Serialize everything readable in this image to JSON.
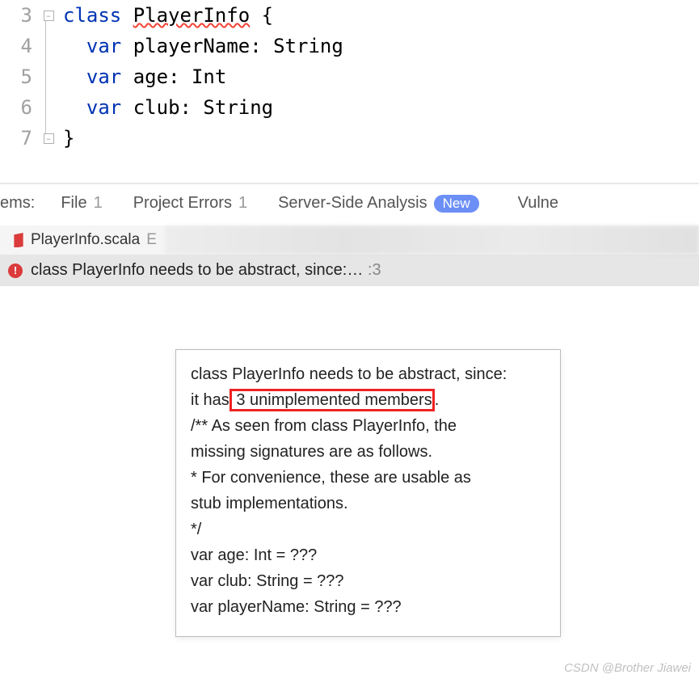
{
  "editor": {
    "lines": [
      {
        "num": "3",
        "indent": "  ",
        "tokens": [
          {
            "t": "keyword",
            "v": "class"
          },
          {
            "t": "sp",
            "v": " "
          },
          {
            "t": "squiggly",
            "v": "PlayerInfo"
          },
          {
            "t": "plain",
            "v": " {"
          }
        ],
        "fold": "open-top"
      },
      {
        "num": "4",
        "indent": "    ",
        "tokens": [
          {
            "t": "keyword",
            "v": "var"
          },
          {
            "t": "sp",
            "v": " "
          },
          {
            "t": "plain",
            "v": "playerName: String"
          }
        ]
      },
      {
        "num": "5",
        "indent": "    ",
        "tokens": [
          {
            "t": "keyword",
            "v": "var"
          },
          {
            "t": "sp",
            "v": " "
          },
          {
            "t": "plain",
            "v": "age: Int"
          }
        ]
      },
      {
        "num": "6",
        "indent": "    ",
        "tokens": [
          {
            "t": "keyword",
            "v": "var"
          },
          {
            "t": "sp",
            "v": " "
          },
          {
            "t": "plain",
            "v": "club: String"
          }
        ]
      },
      {
        "num": "7",
        "indent": "  ",
        "tokens": [
          {
            "t": "plain",
            "v": "}"
          }
        ],
        "fold": "open-bottom"
      }
    ]
  },
  "problems": {
    "left_label": "ems:",
    "tabs": {
      "file": {
        "label": "File",
        "count": "1"
      },
      "project": {
        "label": "Project Errors",
        "count": "1"
      },
      "server": {
        "label": "Server-Side Analysis",
        "badge": "New"
      },
      "vulne": {
        "label": "Vulne"
      }
    }
  },
  "file_tab": {
    "filename": "PlayerInfo.scala",
    "extra": "E"
  },
  "error_row": {
    "message": "class PlayerInfo needs to be abstract, since:…",
    "loc": ":3"
  },
  "tooltip": {
    "line1_pre": "class PlayerInfo needs to be abstract, since:",
    "line2_pre": "it has",
    "highlight": " 3 unimplemented members",
    "line2_post": ".",
    "line3": "/** As seen from class PlayerInfo, the",
    "line4": "missing signatures are as follows.",
    "line5": "* For convenience, these are usable as",
    "line6": "stub implementations.",
    "line7": "*/",
    "line8": "var age: Int = ???",
    "line9": "var club: String = ???",
    "line10": "var playerName: String = ???"
  },
  "watermark": "CSDN @Brother Jiawei"
}
